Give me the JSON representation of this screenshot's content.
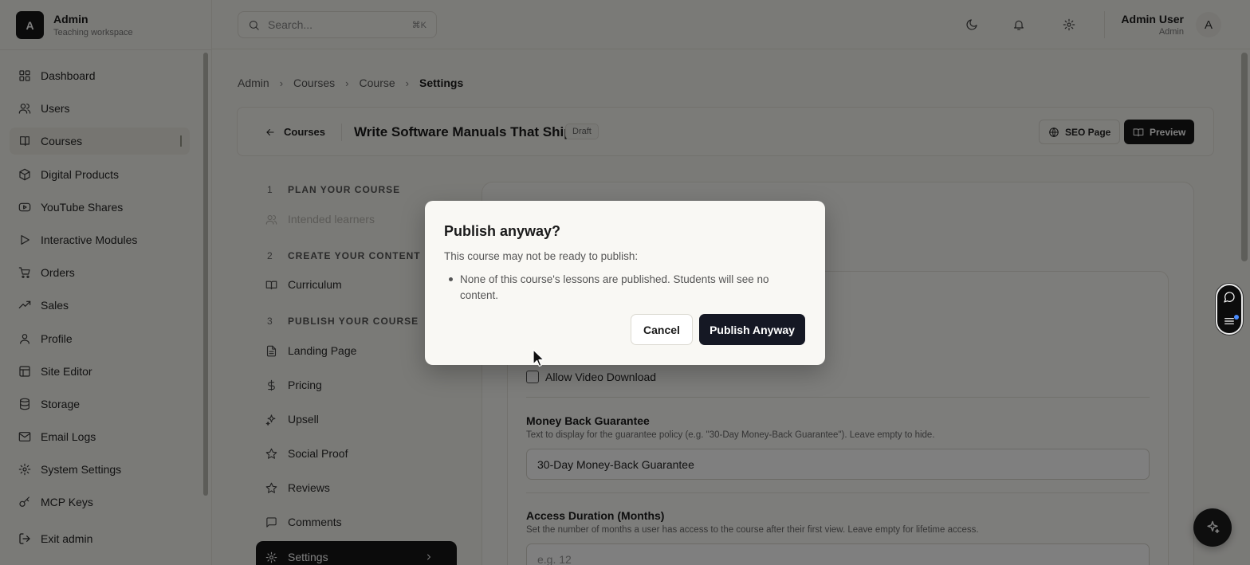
{
  "brand": {
    "logo_letter": "A",
    "title": "Admin",
    "subtitle": "Teaching workspace"
  },
  "sidebar": {
    "items": [
      {
        "label": "Dashboard",
        "icon": "grid-icon"
      },
      {
        "label": "Users",
        "icon": "users-icon"
      },
      {
        "label": "Courses",
        "icon": "book-icon",
        "active": true
      },
      {
        "label": "Digital Products",
        "icon": "package-icon"
      },
      {
        "label": "YouTube Shares",
        "icon": "youtube-icon"
      },
      {
        "label": "Interactive Modules",
        "icon": "play-icon"
      },
      {
        "label": "Orders",
        "icon": "cart-icon"
      },
      {
        "label": "Sales",
        "icon": "trending-icon"
      },
      {
        "label": "Profile",
        "icon": "user-icon"
      },
      {
        "label": "Site Editor",
        "icon": "layout-icon"
      },
      {
        "label": "Storage",
        "icon": "database-icon"
      },
      {
        "label": "Email Logs",
        "icon": "mail-icon"
      },
      {
        "label": "System Settings",
        "icon": "gear-icon"
      },
      {
        "label": "MCP Keys",
        "icon": "key-icon"
      }
    ],
    "exit_label": "Exit admin"
  },
  "topbar": {
    "search_placeholder": "Search...",
    "search_shortcut": "⌘K",
    "user_name": "Admin User",
    "user_role": "Admin",
    "avatar_letter": "A"
  },
  "breadcrumb": [
    "Admin",
    "Courses",
    "Course",
    "Settings"
  ],
  "course_header": {
    "back_label": "Courses",
    "title": "Write Software Manuals That Ship",
    "status": "Draft",
    "seo_label": "SEO Page",
    "preview_label": "Preview"
  },
  "steps": {
    "sections": [
      {
        "num": "1",
        "title": "PLAN YOUR COURSE"
      },
      {
        "num": "2",
        "title": "CREATE YOUR CONTENT"
      },
      {
        "num": "3",
        "title": "PUBLISH YOUR COURSE"
      }
    ],
    "items": [
      "Intended learners",
      "Curriculum",
      "Landing Page",
      "Pricing",
      "Upsell",
      "Social Proof",
      "Reviews",
      "Comments",
      "Settings"
    ]
  },
  "settings_form": {
    "video_download_label": "Allow Video Download",
    "guarantee_label": "Money Back Guarantee",
    "guarantee_help": "Text to display for the guarantee policy (e.g. \"30-Day Money-Back Guarantee\"). Leave empty to hide.",
    "guarantee_value": "30-Day Money-Back Guarantee",
    "access_label": "Access Duration (Months)",
    "access_help": "Set the number of months a user has access to the course after their first view. Leave empty for lifetime access.",
    "access_placeholder": "e.g. 12"
  },
  "modal": {
    "title": "Publish anyway?",
    "description": "This course may not be ready to publish:",
    "warning": "None of this course's lessons are published. Students will see no content.",
    "cancel_label": "Cancel",
    "confirm_label": "Publish Anyway"
  },
  "colors": {
    "overlay": "#000000",
    "primary_button": "#151824",
    "background": "#f5f4ef"
  }
}
